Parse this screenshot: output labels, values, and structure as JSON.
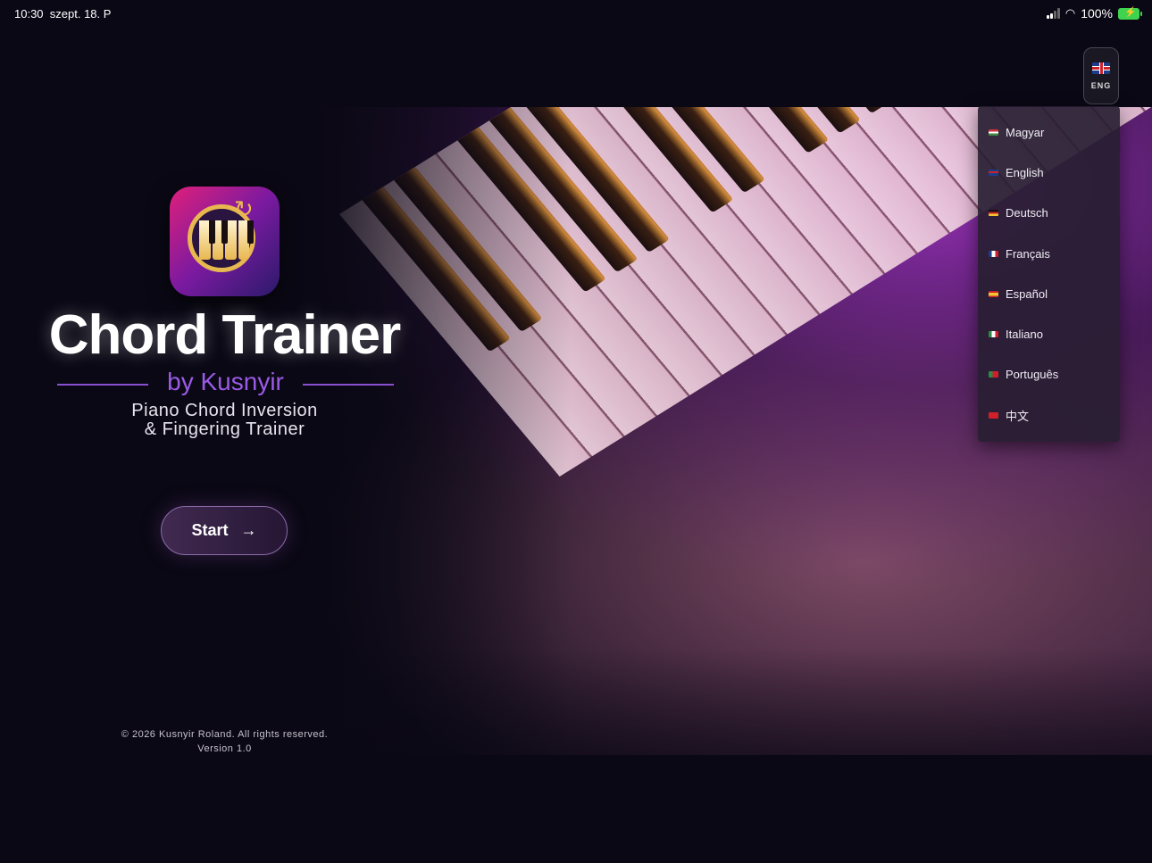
{
  "status_bar": {
    "time": "10:30",
    "date": "szept. 18. P",
    "battery": "100%"
  },
  "language_button": {
    "code": "ENG",
    "flag_icon": "uk-flag-icon"
  },
  "language_menu": {
    "items": [
      {
        "label": "Magyar",
        "flag": "hu"
      },
      {
        "label": "English",
        "flag": "gb"
      },
      {
        "label": "Deutsch",
        "flag": "de"
      },
      {
        "label": "Français",
        "flag": "fr"
      },
      {
        "label": "Español",
        "flag": "es"
      },
      {
        "label": "Italiano",
        "flag": "it"
      },
      {
        "label": "Português",
        "flag": "pt"
      },
      {
        "label": "中文",
        "flag": "cn"
      }
    ]
  },
  "brand": {
    "title": "Chord Trainer",
    "byline": "by Kusnyir",
    "subtitle_line1": "Piano Chord Inversion",
    "subtitle_line2": "& Fingering Trainer"
  },
  "start_button": {
    "label": "Start",
    "icon": "arrow-right-icon"
  },
  "footer": {
    "copyright": "© 2026 Kusnyir Roland. All rights reserved.",
    "version": "Version 1.0"
  },
  "colors": {
    "accent": "#9b5ae6",
    "background": "#0a0814",
    "menu_bg": "#281e32"
  }
}
